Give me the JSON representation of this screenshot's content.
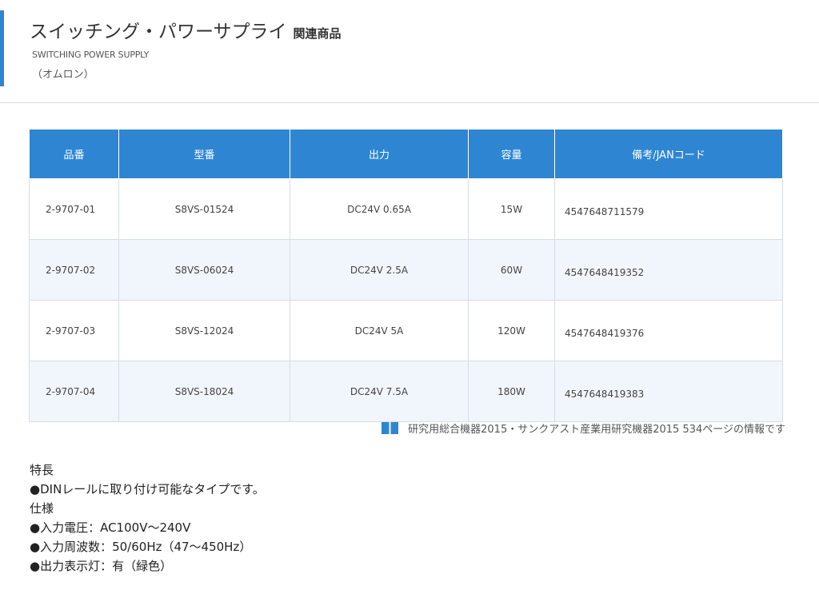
{
  "header": {
    "title": "スイッチング・パワーサプライ",
    "title_sub": "関連商品",
    "subtitle_en": "SWITCHING POWER SUPPLY",
    "maker": "（オムロン）"
  },
  "table": {
    "headers": [
      "品番",
      "型番",
      "出力",
      "容量",
      "備考/JANコード"
    ],
    "rows": [
      [
        "2-9707-01",
        "S8VS-01524",
        "DC24V 0.65A",
        "15W",
        "4547648711579"
      ],
      [
        "2-9707-02",
        "S8VS-06024",
        "DC24V 2.5A",
        "60W",
        "4547648419352"
      ],
      [
        "2-9707-03",
        "S8VS-12024",
        "DC24V 5A",
        "120W",
        "4547648419376"
      ],
      [
        "2-9707-04",
        "S8VS-18024",
        "DC24V 7.5A",
        "180W",
        "4547648419383"
      ]
    ]
  },
  "source_note": {
    "icon": "book-icon",
    "text": "研究用総合機器2015・サンクアスト産業用研究機器2015 534ページの情報です"
  },
  "features": {
    "heading_features": "特長",
    "feature_items": [
      "●DINレールに取り付け可能なタイプです。"
    ],
    "heading_specs": "仕様",
    "spec_items": [
      "●入力電圧：AC100V〜240V",
      "●入力周波数：50/60Hz（47〜450Hz）",
      "●出力表示灯：有（緑色）"
    ]
  },
  "colors": {
    "accent": "#2e86d3",
    "row_alt": "#f1f6fc"
  }
}
